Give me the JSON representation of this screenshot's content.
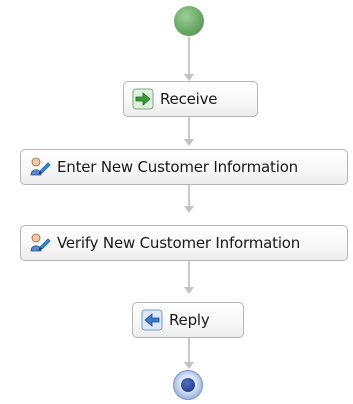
{
  "process": {
    "start": {
      "icon": "start-event-icon"
    },
    "end": {
      "icon": "end-event-icon"
    },
    "steps": [
      {
        "label": "Receive",
        "icon": "receive-arrow-icon"
      },
      {
        "label": "Enter New Customer Information",
        "icon": "human-task-icon"
      },
      {
        "label": "Verify New Customer Information",
        "icon": "human-task-icon"
      },
      {
        "label": "Reply",
        "icon": "reply-arrow-icon"
      }
    ]
  },
  "colors": {
    "start": "#6aa866",
    "end": "#27449a",
    "connector": "#c9c9c9",
    "activity_border": "#b5b5b5"
  }
}
